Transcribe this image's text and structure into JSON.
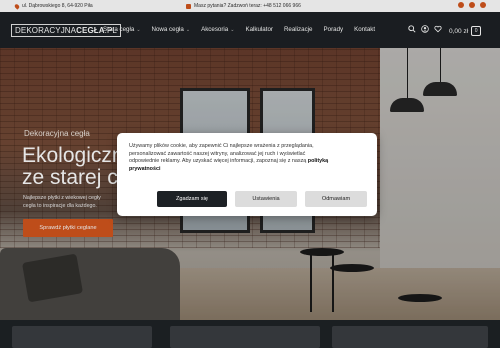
{
  "topbar": {
    "address": "ul. Dąbrowskiego 8, 64-920 Piła",
    "phone": "Masz pytania? Zadzwoń teraz: +48 512 066 966",
    "social_icons": [
      "facebook-icon",
      "instagram-icon",
      "youtube-icon"
    ]
  },
  "nav": {
    "logo_left": "DEKORACYJNA",
    "logo_right": "CEGŁA",
    "logo_suffix": ".PL",
    "items": [
      {
        "label": "Stara cegła",
        "dropdown": true
      },
      {
        "label": "Nowa cegła",
        "dropdown": true
      },
      {
        "label": "Akcesoria",
        "dropdown": true
      },
      {
        "label": "Kalkulator",
        "dropdown": false
      },
      {
        "label": "Realizacje",
        "dropdown": false
      },
      {
        "label": "Porady",
        "dropdown": false
      },
      {
        "label": "Kontakt",
        "dropdown": false
      }
    ],
    "icons": [
      "search-icon",
      "account-icon",
      "heart-icon"
    ],
    "cart_total": "0,00 zł",
    "cart_count": "0"
  },
  "hero": {
    "kicker": "Dekoracyjna cegła",
    "title_line1": "Ekologiczn",
    "title_line2": "ze starej c",
    "desc_line1": "Najlepsze płytki z wiekowej cegły",
    "desc_line2": "cegła to inspiracje dla każdego.",
    "cta": "Sprawdź płytki ceglane"
  },
  "cookie": {
    "text_line1": "Używamy plików cookie, aby zapewnić Ci najlepsze wrażenia z przeglądania,",
    "text_line2": "personalizować zawartość naszej witryny, analizować jej ruch i wyświetlać",
    "text_line3": "odpowiednie reklamy. Aby uzyskać więcej informacji, zapoznaj się z naszą",
    "policy_link": "polityką",
    "policy_link2": "prywatności",
    "accept": "Zgadzam się",
    "settings": "Ustawienia",
    "decline": "Odmawiam"
  },
  "colors": {
    "accent": "#d4561e",
    "dark": "#1d2125"
  }
}
